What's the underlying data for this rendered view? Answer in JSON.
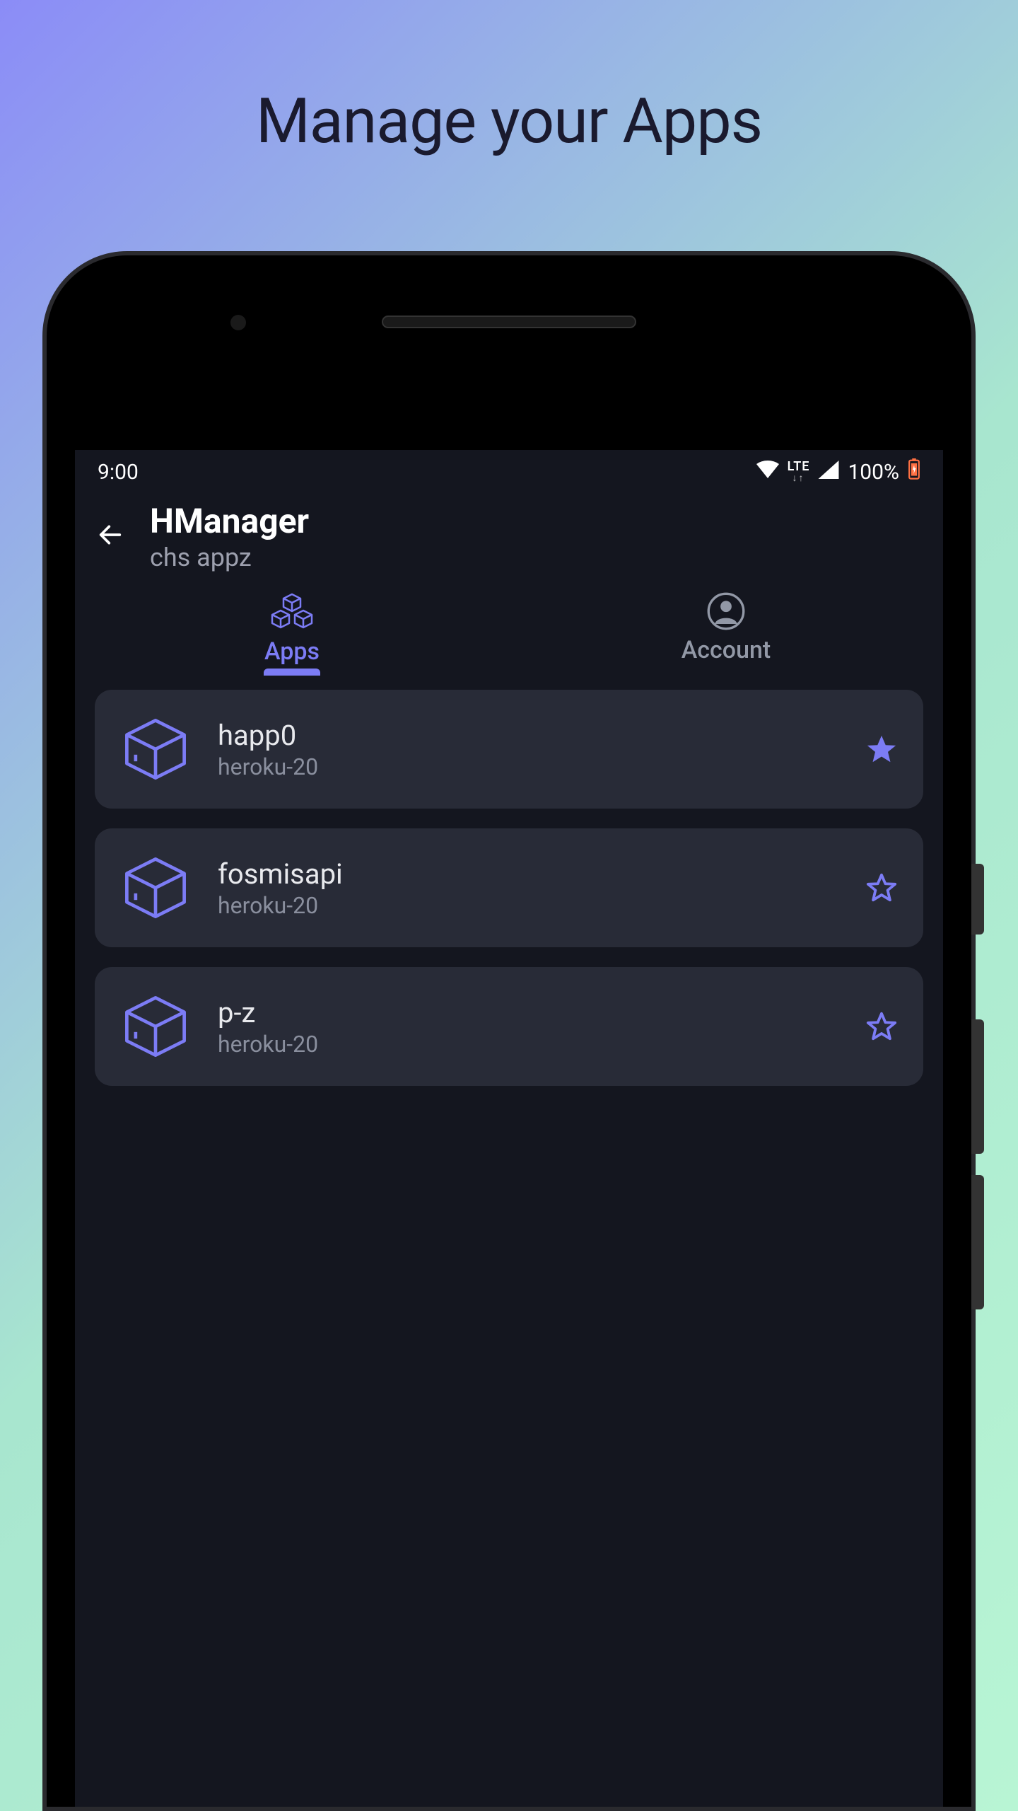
{
  "marketing": {
    "headline": "Manage your Apps"
  },
  "statusbar": {
    "time": "9:00",
    "network_label": "LTE",
    "network_arrows": "↓↑",
    "battery_pct": "100%"
  },
  "header": {
    "title": "HManager",
    "subtitle": "chs appz"
  },
  "tabs": [
    {
      "label": "Apps",
      "icon": "packages-icon",
      "active": true
    },
    {
      "label": "Account",
      "icon": "account-icon",
      "active": false
    }
  ],
  "apps": [
    {
      "name": "happ0",
      "stack": "heroku-20",
      "starred": true
    },
    {
      "name": "fosmisapi",
      "stack": "heroku-20",
      "starred": false
    },
    {
      "name": "p-z",
      "stack": "heroku-20",
      "starred": false
    }
  ],
  "colors": {
    "accent": "#7c7cf5",
    "card_bg": "#282b37",
    "screen_bg": "#14161f",
    "muted_text": "#8a8f9e"
  }
}
